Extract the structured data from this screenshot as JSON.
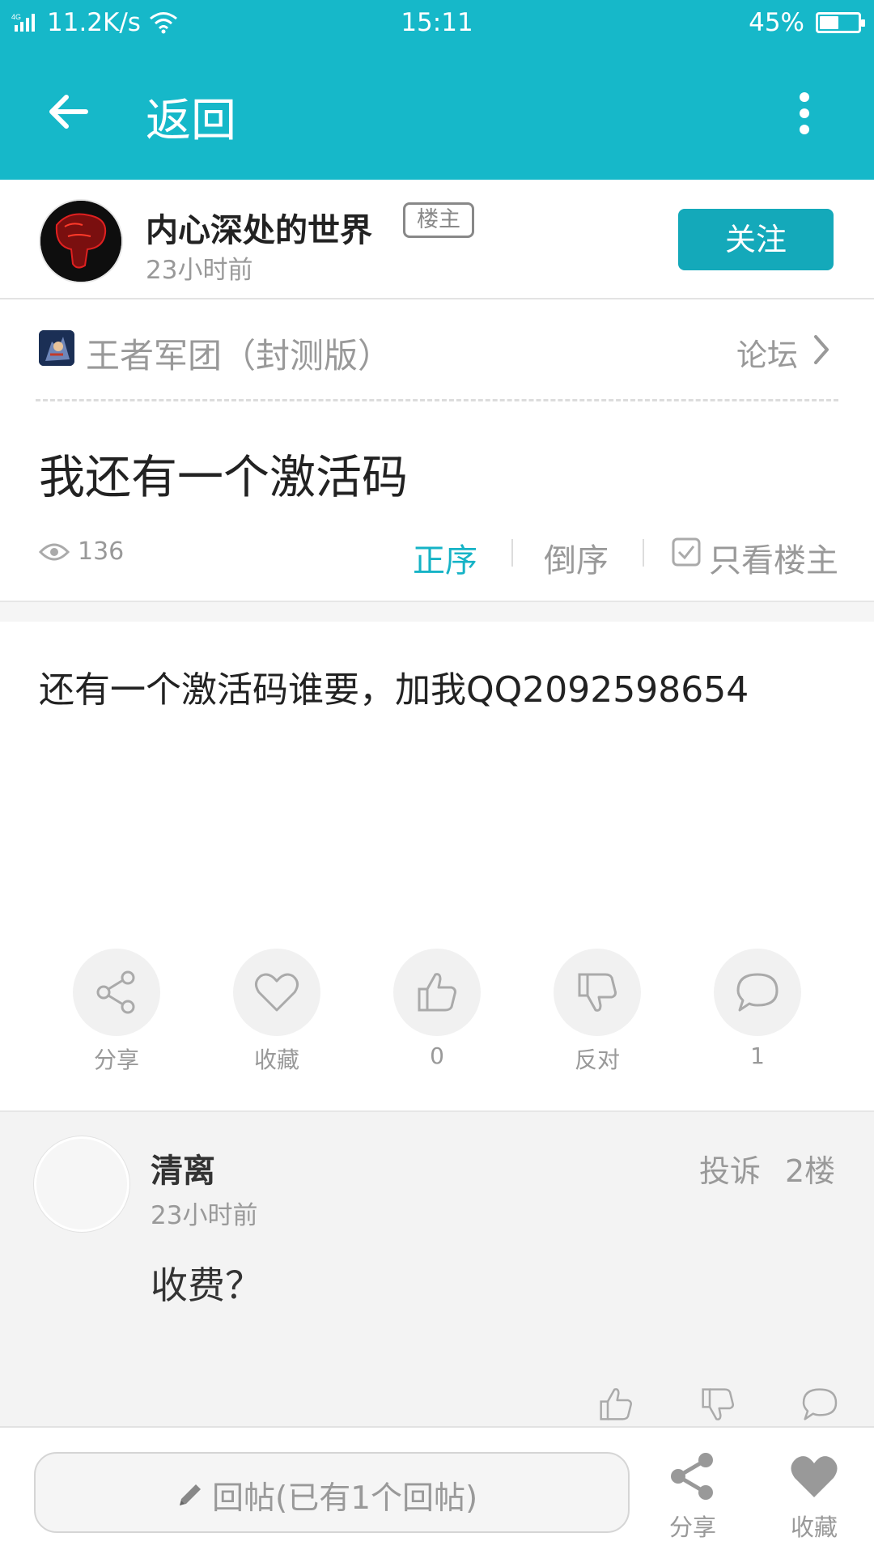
{
  "status_bar": {
    "network": "4G",
    "speed": "11.2K/s",
    "time": "15:11",
    "battery": "45%",
    "battery_level": 0.45
  },
  "header": {
    "back_label": "返回",
    "icons": [
      "back-arrow-icon",
      "more-vertical-icon"
    ],
    "color": "#16b8c9"
  },
  "author": {
    "name": "内心深处的世界",
    "badge": "楼主",
    "time": "23小时前",
    "follow_label": "关注"
  },
  "forum": {
    "name": "王者军团（封测版）",
    "link_label": "论坛"
  },
  "post": {
    "title": "我还有一个激活码",
    "views": "136",
    "sort_normal": "正序",
    "sort_reverse": "倒序",
    "only_op": "只看楼主",
    "content": "还有一个激活码谁要，加我QQ2092598654"
  },
  "actions": [
    {
      "icon": "share-icon",
      "label": "分享"
    },
    {
      "icon": "heart-icon",
      "label": "收藏"
    },
    {
      "icon": "thumbs-up-icon",
      "label": "0"
    },
    {
      "icon": "thumbs-down-icon",
      "label": "反对"
    },
    {
      "icon": "comment-icon",
      "label": "1"
    }
  ],
  "reply": {
    "name": "清离",
    "time": "23小时前",
    "report_label": "投诉",
    "floor": "2楼",
    "text": "收费？"
  },
  "bottom_bar": {
    "reply_placeholder": "回帖(已有1个回帖)",
    "share_label": "分享",
    "fav_label": "收藏"
  },
  "accent_color": "#14a9ba"
}
